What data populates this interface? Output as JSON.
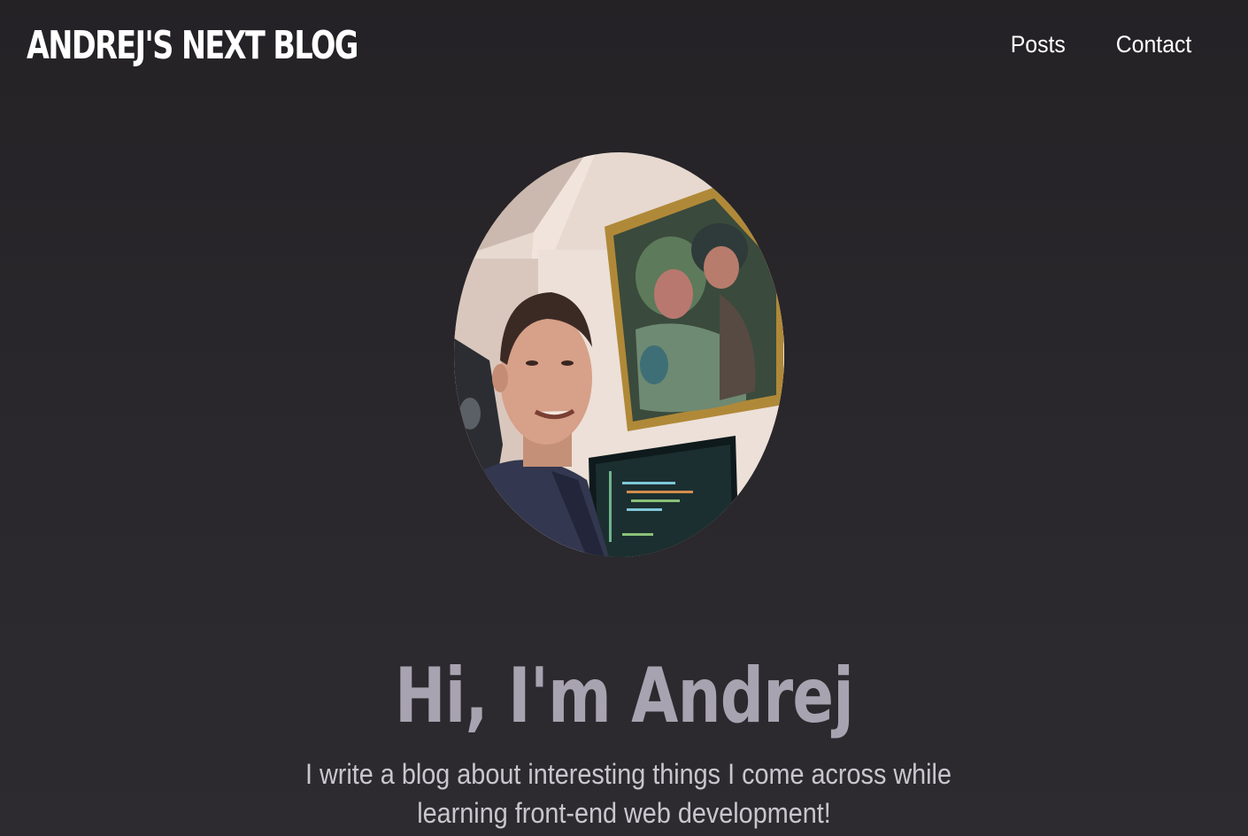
{
  "header": {
    "logo": "ANDREJ'S NEXT BLOG",
    "nav": [
      {
        "label": "Posts"
      },
      {
        "label": "Contact"
      }
    ]
  },
  "hero": {
    "title": "Hi, I'm Andrej",
    "subtitle_line1": "I write a blog about interesting things I come across while",
    "subtitle_line2": "learning front-end web development!",
    "avatar_icon": "profile-photo"
  },
  "colors": {
    "background": "#29272b",
    "title": "#a8a3b0",
    "text": "#ffffff",
    "subtitle": "#c9c6cf"
  }
}
